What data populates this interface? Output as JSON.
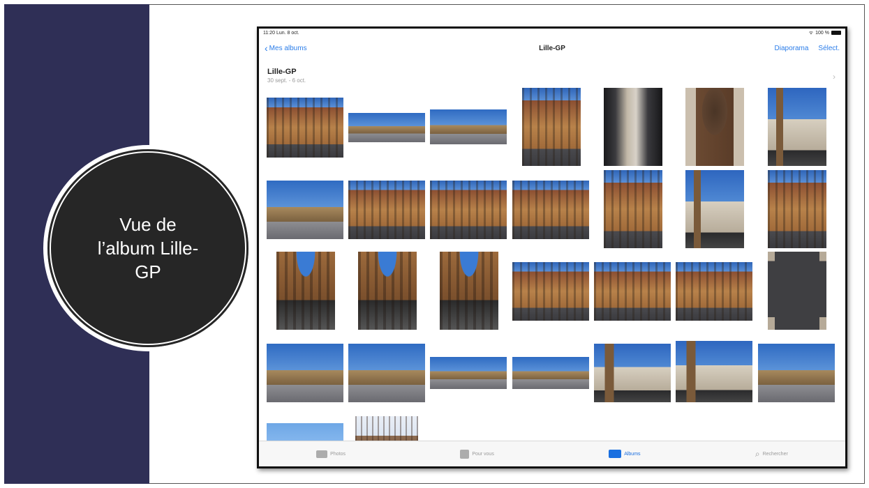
{
  "slide": {
    "title": "Vue de\nl’album Lille-\nGP"
  },
  "ipad": {
    "status": {
      "time": "11:20  Lun. 8 oct.",
      "battery": "100 %"
    },
    "nav": {
      "back_label": "Mes albums",
      "title": "Lille-GP",
      "slideshow_label": "Diaporama",
      "select_label": "Sélect."
    },
    "album": {
      "name": "Lille-GP",
      "dates": "30 sept. - 6 oct."
    },
    "tabs": [
      {
        "label": "Photos",
        "icon": "photos-icon"
      },
      {
        "label": "Pour vous",
        "icon": "for-you-icon"
      },
      {
        "label": "Albums",
        "icon": "albums-icon",
        "active": true
      },
      {
        "label": "Rechercher",
        "icon": "search-icon"
      }
    ]
  },
  "colors": {
    "side_band": "#2f2f56",
    "circle": "#262626",
    "accent": "#2b7de9"
  }
}
